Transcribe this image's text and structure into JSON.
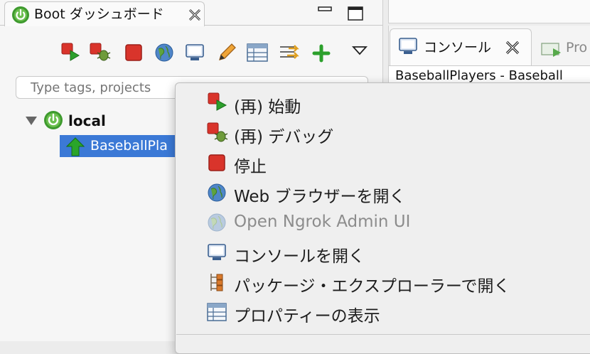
{
  "colors": {
    "selection": "#3b79d6",
    "accent_green": "#2ca02c",
    "stop_red": "#d9342b"
  },
  "boot_dashboard": {
    "tab_title": "Boot ダッシュボード",
    "tab_icon": "spring-power-icon",
    "toolbar_icons": [
      "restart-icon",
      "debug-icon",
      "stop-icon",
      "globe-icon",
      "console-icon",
      "edit-pencil-icon",
      "table-icon",
      "filter-arrows-icon",
      "add-icon",
      "view-menu-icon"
    ],
    "filter_placeholder": "Type tags, projects",
    "tree": {
      "root": "local",
      "app": "BaseballPla"
    }
  },
  "console_view": {
    "tab_title": "コンソール",
    "other_tab": "Pro",
    "header": "BaseballPlayers - Baseball"
  },
  "context_menu": {
    "items": [
      {
        "label": "(再) 始動",
        "icon": "restart-icon",
        "enabled": true
      },
      {
        "label": "(再) デバッグ",
        "icon": "debug-icon",
        "enabled": true
      },
      {
        "label": "停止",
        "icon": "stop-icon",
        "enabled": true
      },
      {
        "label": "Web ブラウザーを開く",
        "icon": "globe-icon",
        "enabled": true
      },
      {
        "label": "Open Ngrok Admin UI",
        "icon": "globe-icon",
        "enabled": false
      },
      {
        "label": "コンソールを開く",
        "icon": "console-icon",
        "enabled": true
      },
      {
        "label": "パッケージ・エクスプローラーで開く",
        "icon": "package-explorer-icon",
        "enabled": true
      },
      {
        "label": "プロパティーの表示",
        "icon": "properties-table-icon",
        "enabled": true
      }
    ]
  }
}
